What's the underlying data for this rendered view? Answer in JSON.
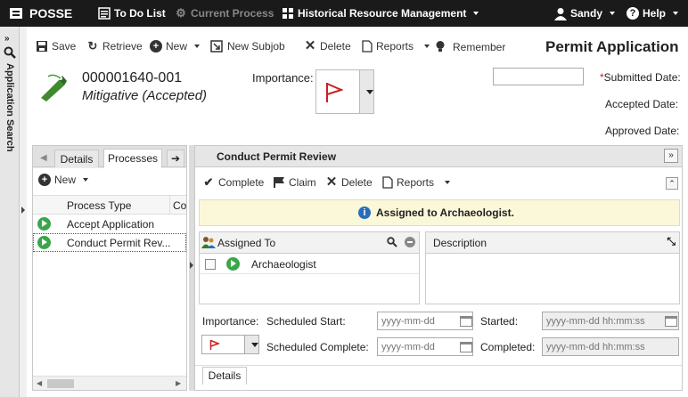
{
  "topbar": {
    "brand": "POSSE",
    "todo": "To Do List",
    "current_process": "Current Process",
    "historical": "Historical Resource Management",
    "user": "Sandy",
    "help": "Help"
  },
  "side": {
    "label": "Application Search"
  },
  "toolbar": {
    "save": "Save",
    "retrieve": "Retrieve",
    "new": "New",
    "new_subjob": "New Subjob",
    "delete": "Delete",
    "reports": "Reports",
    "remember": "Remember",
    "page_title": "Permit Application"
  },
  "header": {
    "job_number": "000001640-001",
    "job_status": "Mitigative (Accepted)",
    "importance_label": "Importance:",
    "submitted_label": "Submitted Date:",
    "required_mark": "*",
    "accepted_label": "Accepted Date:",
    "approved_label": "Approved Date:",
    "submitted_value": ""
  },
  "left_panel": {
    "tabs": [
      "Details",
      "Processes"
    ],
    "new_label": "New",
    "columns": [
      "Process Type",
      "Co"
    ],
    "rows": [
      {
        "type": "Accept Application"
      },
      {
        "type": "Conduct Permit Rev..."
      }
    ]
  },
  "right_panel": {
    "title": "Conduct Permit Review",
    "complete": "Complete",
    "claim": "Claim",
    "delete": "Delete",
    "reports": "Reports",
    "banner": "Assigned to Archaeologist.",
    "assigned_header": "Assigned To",
    "assignee": "Archaeologist",
    "description_header": "Description",
    "importance_label": "Importance:",
    "scheduled_start_label": "Scheduled Start:",
    "scheduled_complete_label": "Scheduled Complete:",
    "started_label": "Started:",
    "completed_label": "Completed:",
    "date_placeholder": "yyyy-mm-dd",
    "datetime_placeholder": "yyyy-mm-dd hh:mm:ss",
    "details_tab": "Details"
  },
  "colors": {
    "accent_blue": "#2a6ebb",
    "flag_red": "#cc1f1f",
    "banner_bg": "#fbf7d9",
    "play_green": "#3aa64a"
  }
}
